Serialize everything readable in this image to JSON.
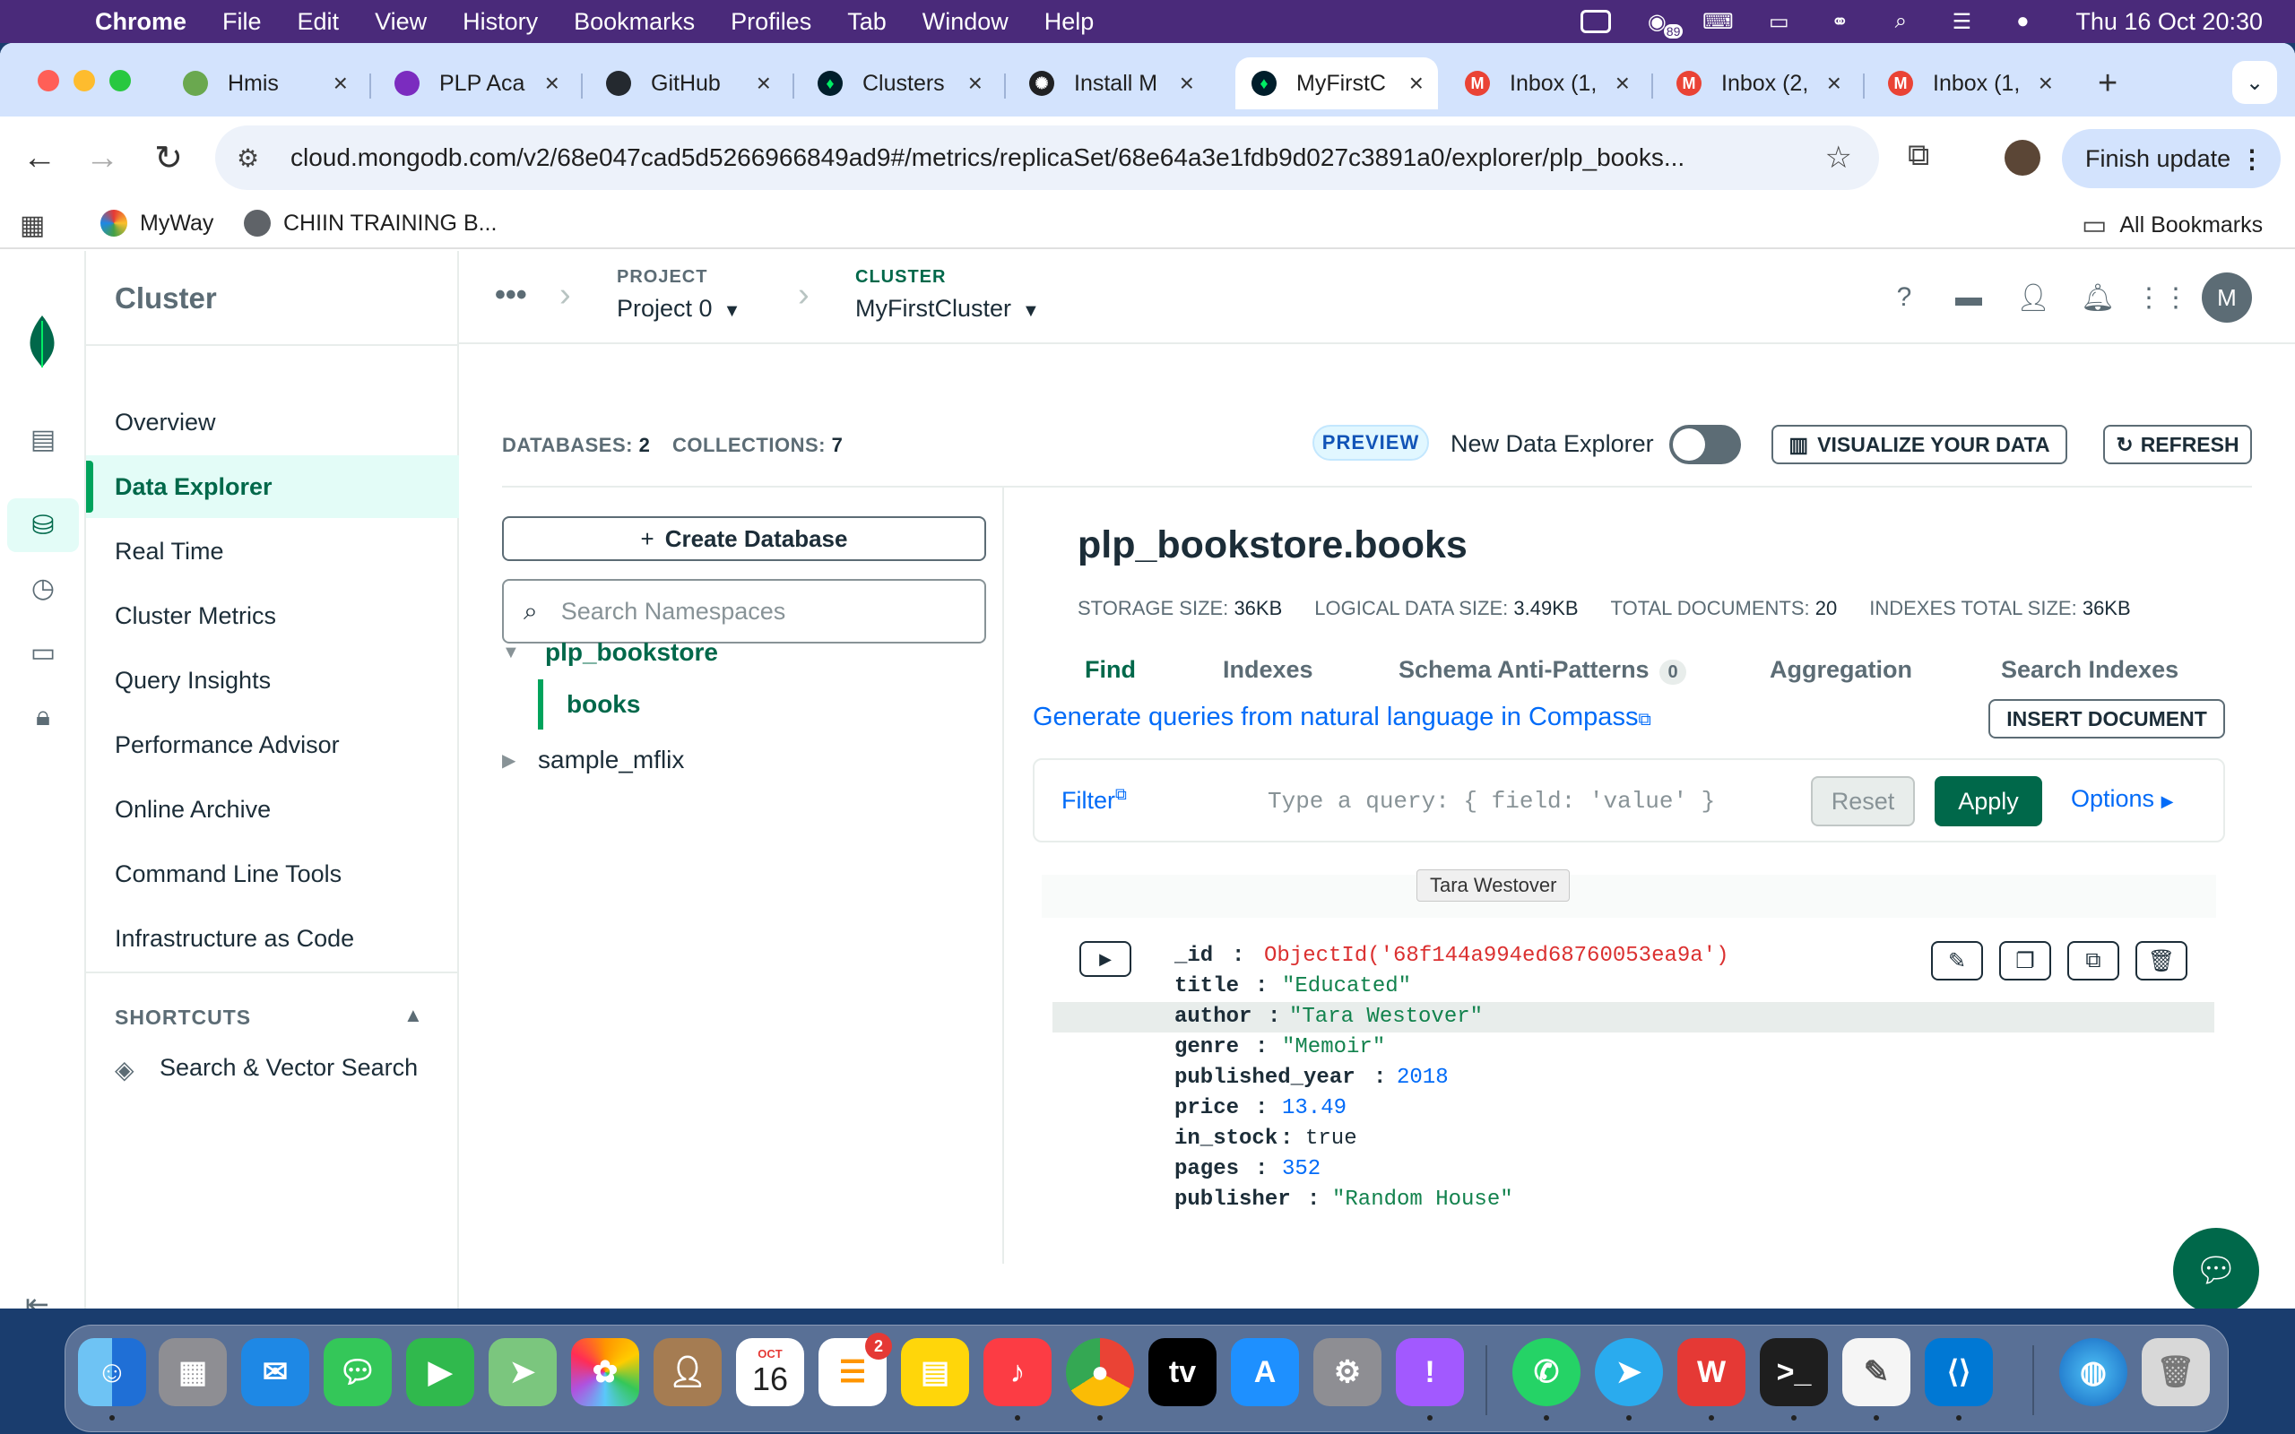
{
  "menubar": {
    "app": "Chrome",
    "items": [
      "File",
      "Edit",
      "View",
      "History",
      "Bookmarks",
      "Profiles",
      "Tab",
      "Window",
      "Help"
    ],
    "badge_count": "89",
    "clock": "Thu 16 Oct  20:30"
  },
  "tabs": [
    {
      "title": "Hmis",
      "favicon": "hmis-icon",
      "color": "#6aa84f"
    },
    {
      "title": "PLP Aca",
      "favicon": "plp-icon",
      "color": "#7b2cbf"
    },
    {
      "title": "GitHub",
      "favicon": "github-icon",
      "color": "#24292f"
    },
    {
      "title": "Clusters",
      "favicon": "mongodb-leaf-icon",
      "color": "#001e2b"
    },
    {
      "title": "Install M",
      "favicon": "openai-icon",
      "color": "#202123"
    },
    {
      "title": "MyFirstC",
      "favicon": "mongodb-leaf-icon",
      "color": "#001e2b"
    },
    {
      "title": "Inbox (1,",
      "favicon": "gmail-icon",
      "color": "#ea4335"
    },
    {
      "title": "Inbox (2,",
      "favicon": "gmail-icon",
      "color": "#ea4335"
    },
    {
      "title": "Inbox (1,",
      "favicon": "gmail-icon",
      "color": "#ea4335"
    }
  ],
  "omnibox": {
    "url": "cloud.mongodb.com/v2/68e047cad5d5266966849ad9#/metrics/replicaSet/68e64a3e1fdb9d027c3891a0/explorer/plp_books..."
  },
  "finish_update": "Finish update",
  "bookmarks": {
    "items": [
      "MyWay",
      "CHIIN TRAINING B..."
    ],
    "all": "All Bookmarks"
  },
  "leftnav": {
    "header": "Cluster",
    "items": [
      "Overview",
      "Data Explorer",
      "Real Time",
      "Cluster Metrics",
      "Query Insights",
      "Performance Advisor",
      "Online Archive",
      "Command Line Tools",
      "Infrastructure as Code"
    ],
    "shortcuts_label": "SHORTCUTS",
    "shortcut_item": "Search & Vector Search"
  },
  "topbar": {
    "project_label": "PROJECT",
    "project_value": "Project 0",
    "cluster_label": "CLUSTER",
    "cluster_value": "MyFirstCluster",
    "avatar": "M"
  },
  "explorer": {
    "databases_label": "DATABASES:",
    "databases_count": "2",
    "collections_label": "COLLECTIONS:",
    "collections_count": "7",
    "preview": "PREVIEW",
    "new_data_explorer": "New Data Explorer",
    "visualize": "VISUALIZE YOUR DATA",
    "refresh": "REFRESH"
  },
  "namespaces": {
    "create_db": "Create Database",
    "search_placeholder": "Search Namespaces",
    "db1": "plp_bookstore",
    "collection": "books",
    "db2": "sample_mflix"
  },
  "collection": {
    "title": "plp_bookstore.books",
    "stats": [
      {
        "label": "STORAGE SIZE:",
        "value": "36KB"
      },
      {
        "label": "LOGICAL DATA SIZE:",
        "value": "3.49KB"
      },
      {
        "label": "TOTAL DOCUMENTS:",
        "value": "20"
      },
      {
        "label": "INDEXES TOTAL SIZE:",
        "value": "36KB"
      }
    ],
    "tabs": [
      "Find",
      "Indexes",
      "Schema Anti-Patterns",
      "Aggregation",
      "Search Indexes"
    ],
    "anti_patterns_count": "0",
    "generate_link": "Generate queries from natural language in Compass",
    "insert_document": "INSERT DOCUMENT",
    "filter_label": "Filter",
    "filter_placeholder": "Type a query: { field: 'value' }",
    "reset": "Reset",
    "apply": "Apply",
    "options": "Options"
  },
  "document": {
    "fields": [
      {
        "key": "_id",
        "value": "ObjectId('68f144a994ed68760053ea9a')",
        "type": "oid"
      },
      {
        "key": "title",
        "value": "\"Educated\"",
        "type": "str"
      },
      {
        "key": "author",
        "value": "\"Tara Westover\"",
        "type": "str"
      },
      {
        "key": "genre",
        "value": "\"Memoir\"",
        "type": "str"
      },
      {
        "key": "published_year",
        "value": "2018",
        "type": "num"
      },
      {
        "key": "price",
        "value": "13.49",
        "type": "num"
      },
      {
        "key": "in_stock",
        "value": "true",
        "type": "bool"
      },
      {
        "key": "pages",
        "value": "352",
        "type": "num"
      },
      {
        "key": "publisher",
        "value": "\"Random House\"",
        "type": "str"
      }
    ],
    "tooltip": "Tara Westover"
  },
  "dock": {
    "calendar_month": "OCT",
    "calendar_day": "16",
    "reminders_badge": "2"
  }
}
